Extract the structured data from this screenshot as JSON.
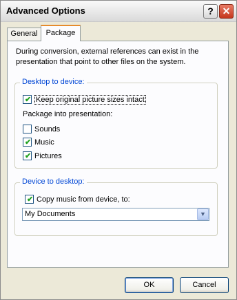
{
  "window": {
    "title": "Advanced Options",
    "help_glyph": "?",
    "close_glyph": "✕"
  },
  "tabs": [
    {
      "label": "General",
      "active": false
    },
    {
      "label": "Package",
      "active": true
    }
  ],
  "intro": "During conversion, external references can exist in the presentation that point to other files on the system.",
  "desktop_to_device": {
    "label": "Desktop to device:",
    "keep_sizes": {
      "label": "Keep original picture sizes intact",
      "checked": true
    },
    "package_label": "Package into presentation:",
    "sounds": {
      "label": "Sounds",
      "checked": false
    },
    "music": {
      "label": "Music",
      "checked": true
    },
    "pictures": {
      "label": "Pictures",
      "checked": true
    }
  },
  "device_to_desktop": {
    "label": "Device to desktop:",
    "copy_music": {
      "label": "Copy music from device, to:",
      "checked": true
    },
    "destination": {
      "selected": "My Documents"
    }
  },
  "buttons": {
    "ok": "OK",
    "cancel": "Cancel"
  },
  "colors": {
    "group_label": "#0046d5",
    "tab_highlight": "#e68b2c",
    "check": "#21a121"
  }
}
